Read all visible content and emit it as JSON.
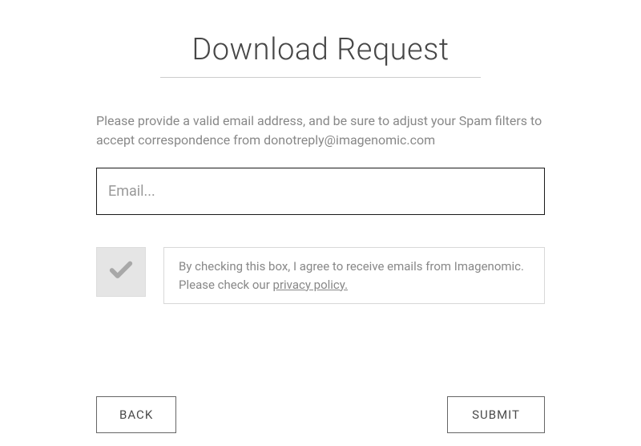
{
  "title": "Download Request",
  "instructions": "Please provide a valid email address, and be sure to adjust your Spam filters to accept correspondence from donotreply@imagenomic.com",
  "email": {
    "placeholder": "Email...",
    "value": ""
  },
  "consent": {
    "text_before": "By checking this box, I agree to receive emails from Imagenomic. Please check our ",
    "link_text": "privacy policy.",
    "checked": false
  },
  "buttons": {
    "back": "BACK",
    "submit": "SUBMIT"
  },
  "colors": {
    "check_icon": "#a8a8a8"
  }
}
